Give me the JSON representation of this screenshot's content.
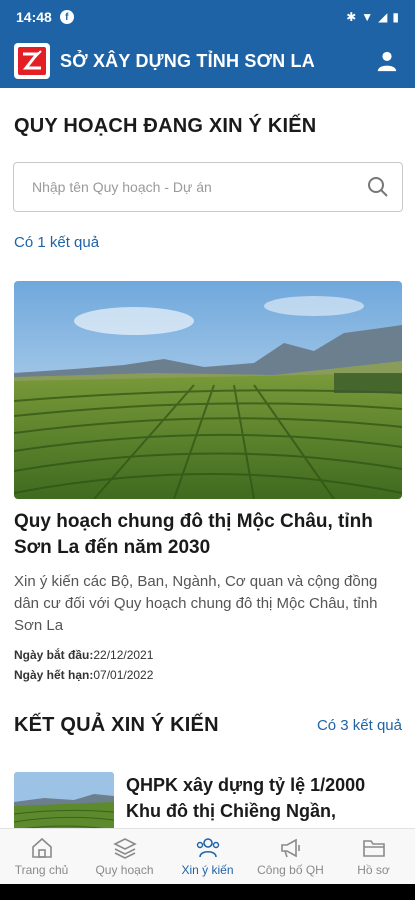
{
  "status_bar": {
    "time": "14:48"
  },
  "app_bar": {
    "title": "SỞ XÂY DỰNG TỈNH SƠN LA"
  },
  "page": {
    "title": "QUY HOẠCH ĐANG XIN Ý KIẾN",
    "search_placeholder": "Nhập tên Quy hoạch - Dự án",
    "result_count": "Có 1 kết quả"
  },
  "card": {
    "title": "Quy hoạch chung đô thị Mộc Châu, tỉnh Sơn La đến năm 2030",
    "description": "Xin ý kiến các Bộ, Ban, Ngành, Cơ quan và cộng đồng dân cư đối với Quy hoạch chung đô thị Mộc Châu, tỉnh Sơn La",
    "start_label": "Ngày bắt đầu:",
    "start_date": "22/12/2021",
    "end_label": "Ngày hết hạn:",
    "end_date": "07/01/2022"
  },
  "results": {
    "title": "KẾT QUẢ XIN Ý KIẾN",
    "count_link": "Có 3 kết quả",
    "first_item_title": "QHPK xây dựng tỷ lệ 1/2000 Khu đô thị Chiềng Ngần,"
  },
  "bottom_nav": [
    {
      "label": "Trang chủ",
      "icon": "home-icon"
    },
    {
      "label": "Quy hoạch",
      "icon": "layers-icon"
    },
    {
      "label": "Xin ý kiến",
      "icon": "users-icon",
      "active": true
    },
    {
      "label": "Công bố QH",
      "icon": "megaphone-icon"
    },
    {
      "label": "Hồ sơ",
      "icon": "folder-icon"
    }
  ],
  "colors": {
    "primary": "#1f63a7",
    "nav_inactive": "#8a8a8a"
  }
}
